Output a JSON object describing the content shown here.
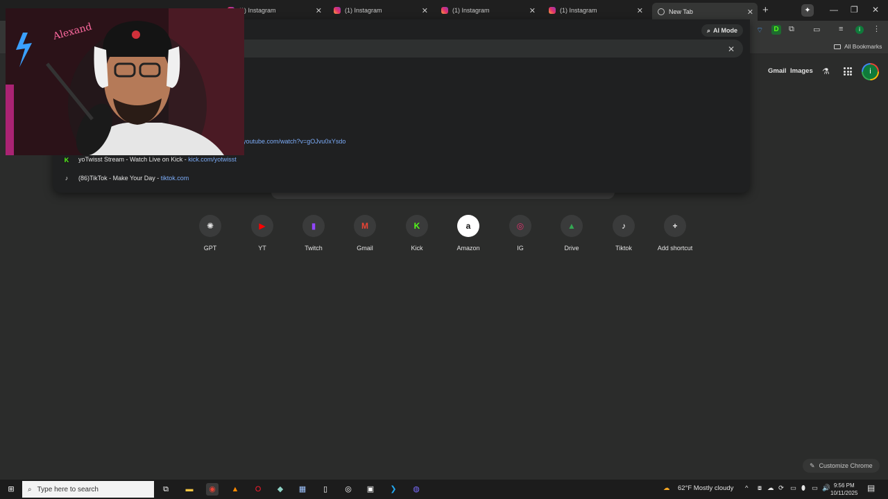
{
  "tabs": [
    {
      "label": "(1) Instagram",
      "active": false
    },
    {
      "label": "(1) Instagram",
      "active": false
    },
    {
      "label": "(1) Instagram",
      "active": false
    },
    {
      "label": "(1) Instagram",
      "active": false
    },
    {
      "label": "(1) Instagram",
      "active": false
    },
    {
      "label": "New Tab",
      "active": true
    }
  ],
  "toolbar": {
    "ai_mode_label": "AI Mode",
    "all_bookmarks_label": "All Bookmarks"
  },
  "omnibox": {
    "suggestions": [
      {
        "title": "",
        "url": "youtube.com/watch?v=gOJvu0xYsdo"
      },
      {
        "title": "yoTwisst Stream - Watch Live on Kick",
        "sep": " - ",
        "url": "kick.com/yotwisst"
      },
      {
        "title": "(86)TikTok - Make Your Day",
        "sep": " - ",
        "url": "tiktok.com"
      }
    ]
  },
  "header_links": {
    "gmail": "Gmail",
    "images": "Images",
    "avatar_letter": "i"
  },
  "shortcuts": [
    {
      "label": "GPT",
      "icon": "openai-icon",
      "glyph": "✺",
      "color": "#e3e3e3"
    },
    {
      "label": "YT",
      "icon": "youtube-icon",
      "glyph": "▶",
      "color": "#ff0000"
    },
    {
      "label": "Twitch",
      "icon": "twitch-icon",
      "glyph": "▮",
      "color": "#9146ff"
    },
    {
      "label": "Gmail",
      "icon": "gmail-icon",
      "glyph": "M",
      "color": "#ea4335"
    },
    {
      "label": "Kick",
      "icon": "kick-icon",
      "glyph": "K",
      "color": "#53fc18"
    },
    {
      "label": "Amazon",
      "icon": "amazon-icon",
      "glyph": "a",
      "color": "#111111"
    },
    {
      "label": "IG",
      "icon": "instagram-icon",
      "glyph": "◎",
      "color": "#e1306c"
    },
    {
      "label": "Drive",
      "icon": "drive-icon",
      "glyph": "▲",
      "color": "#34a853"
    },
    {
      "label": "Tiktok",
      "icon": "tiktok-icon",
      "glyph": "♪",
      "color": "#ffffff"
    },
    {
      "label": "Add shortcut",
      "icon": "plus-icon",
      "glyph": "+",
      "color": "#e3e3e3"
    }
  ],
  "customize_label": "Customize Chrome",
  "taskbar": {
    "search_placeholder": "Type here to search",
    "weather": "62°F  Mostly cloudy",
    "time": "9:56 PM",
    "date": "10/11/2025"
  }
}
